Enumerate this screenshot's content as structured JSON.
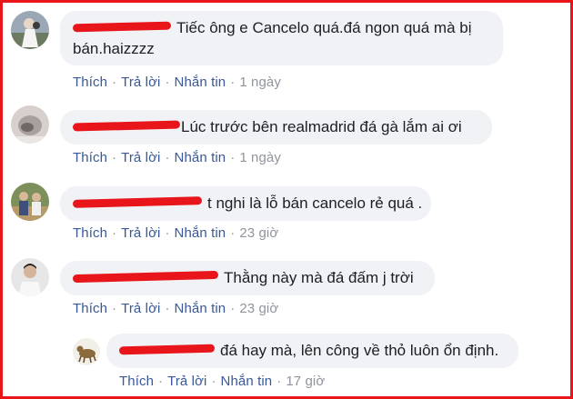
{
  "comments": [
    {
      "text": "Tiếc ông e Cancelo quá.đá ngon quá mà bị bán.haizzzz",
      "actions": {
        "like": "Thích",
        "reply": "Trả lời",
        "message": "Nhắn tin",
        "time": "1 ngày"
      }
    },
    {
      "text": "Lúc trước bên realmadrid đá gà lắm ai ơi",
      "actions": {
        "like": "Thích",
        "reply": "Trả lời",
        "message": "Nhắn tin",
        "time": "1 ngày"
      }
    },
    {
      "text": "t nghi là lỗ bán cancelo rẻ quá .",
      "actions": {
        "like": "Thích",
        "reply": "Trả lời",
        "message": "Nhắn tin",
        "time": "23 giờ"
      }
    },
    {
      "text": "Thằng này mà đá đấm j trời",
      "actions": {
        "like": "Thích",
        "reply": "Trả lời",
        "message": "Nhắn tin",
        "time": "23 giờ"
      }
    },
    {
      "text": "đá hay mà, lên công về thỏ luôn ổn định.",
      "actions": {
        "like": "Thích",
        "reply": "Trả lời",
        "message": "Nhắn tin",
        "time": "17 giờ"
      }
    }
  ],
  "separator": "·",
  "colors": {
    "border": "#e8161b",
    "bubble": "#f0f2f5",
    "link": "#385898",
    "meta": "#90949c"
  }
}
